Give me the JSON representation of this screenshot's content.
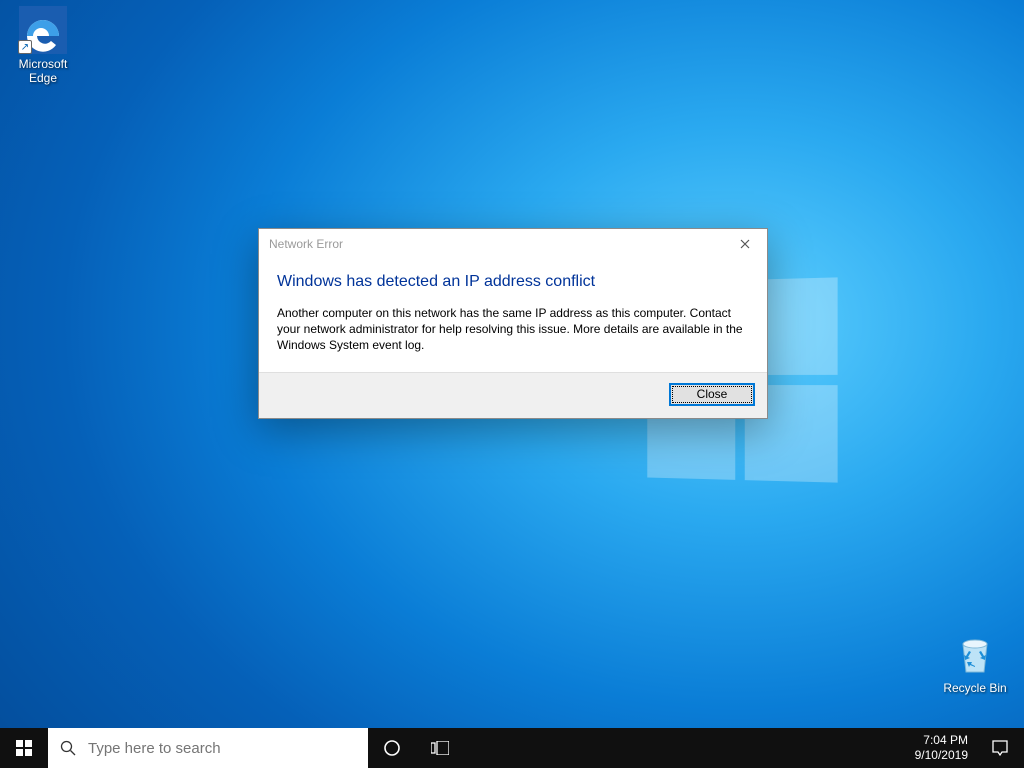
{
  "desktop": {
    "icons": {
      "edge": {
        "label": "Microsoft Edge"
      },
      "recycle": {
        "label": "Recycle Bin"
      }
    }
  },
  "dialog": {
    "title": "Network Error",
    "heading": "Windows has detected an IP address conflict",
    "body": "Another computer on this network has the same IP address as this computer. Contact your network administrator for help resolving this issue. More details are available in the Windows System event log.",
    "close_button": "Close"
  },
  "taskbar": {
    "search_placeholder": "Type here to search",
    "clock": {
      "time": "7:04 PM",
      "date": "9/10/2019"
    }
  }
}
